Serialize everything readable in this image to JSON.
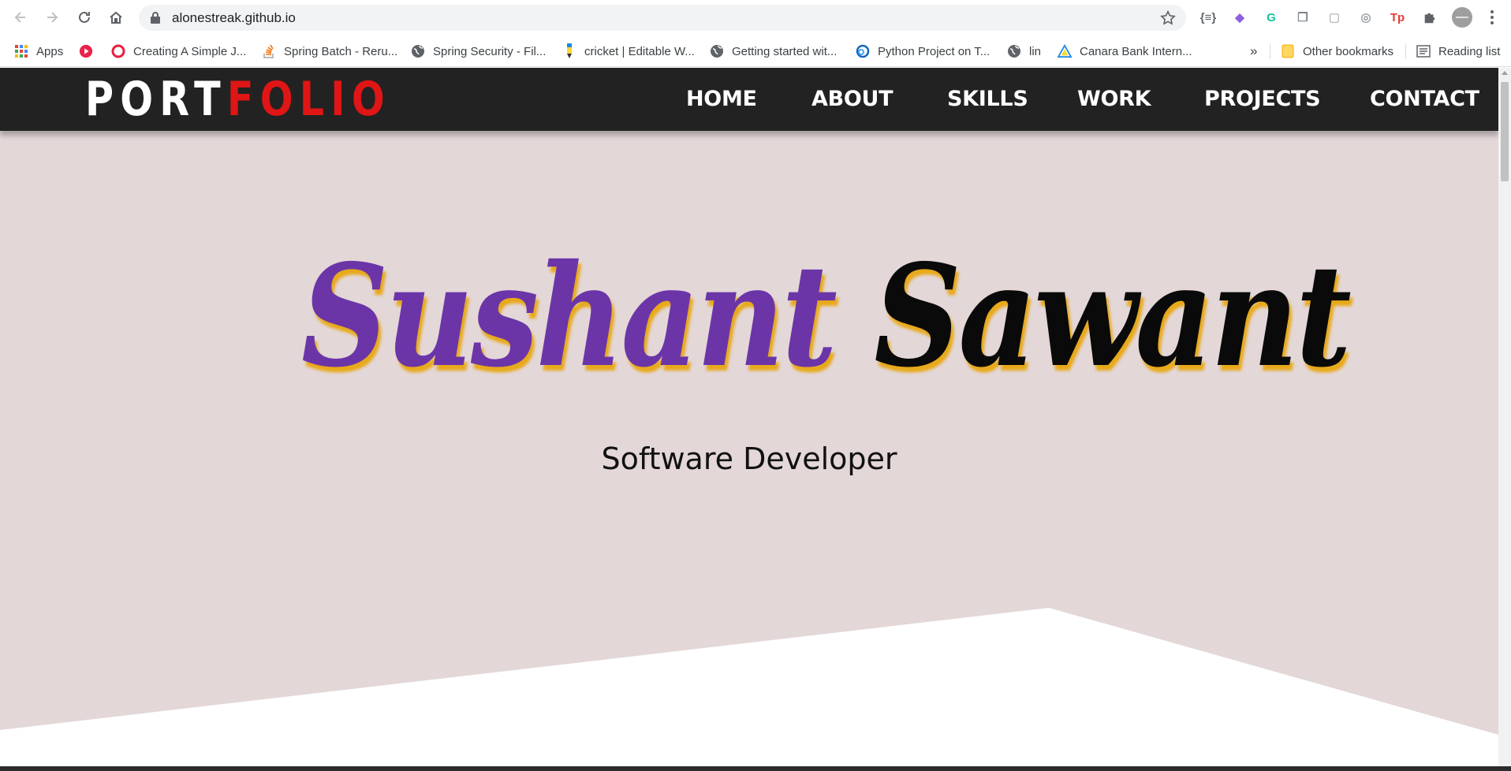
{
  "browser": {
    "url": "alonestreak.github.io",
    "icons": {
      "back": "arrow-left-icon",
      "forward": "arrow-right-icon",
      "reload": "reload-icon",
      "home": "home-icon",
      "lock": "lock-icon",
      "star": "star-icon",
      "extensions": "puzzle-icon",
      "menu": "kebab-menu-icon"
    },
    "extensions": [
      {
        "name": "json-viewer-extension-icon",
        "glyph": "{≡}",
        "color": "#5f6368"
      },
      {
        "name": "purple-extension-icon",
        "glyph": "◆",
        "color": "#8e5fe0"
      },
      {
        "name": "grammarly-extension-icon",
        "glyph": "G",
        "color": "#15c39a"
      },
      {
        "name": "copy-extension-icon",
        "glyph": "❐",
        "color": "#80868b"
      },
      {
        "name": "blank-extension-icon",
        "glyph": "▢",
        "color": "#bdbdbd"
      },
      {
        "name": "target-extension-icon",
        "glyph": "◎",
        "color": "#9aa0a6"
      },
      {
        "name": "tp-extension-icon",
        "glyph": "Tp",
        "color": "#e53935"
      }
    ]
  },
  "bookmarks": {
    "items": [
      {
        "label": "Apps",
        "icon": "apps-grid-icon"
      },
      {
        "label": "",
        "icon": "play-circle-icon"
      },
      {
        "label": "Creating A Simple J...",
        "icon": "opera-icon"
      },
      {
        "label": "Spring Batch - Reru...",
        "icon": "stack-overflow-icon"
      },
      {
        "label": "Spring Security - Fil...",
        "icon": "globe-icon"
      },
      {
        "label": "cricket | Editable W...",
        "icon": "pencil-icon"
      },
      {
        "label": "Getting started wit...",
        "icon": "globe-icon"
      },
      {
        "label": "Python Project on T...",
        "icon": "link-icon"
      },
      {
        "label": "lin",
        "icon": "globe-icon"
      },
      {
        "label": "Canara Bank Intern...",
        "icon": "triangle-icon"
      }
    ],
    "overflow": "»",
    "other": "Other bookmarks",
    "reading_list": "Reading list"
  },
  "site": {
    "logo": {
      "part1": "PORT",
      "part2": "FOLIO"
    },
    "menu": [
      "HOME",
      "ABOUT",
      "SKILLS",
      "WORK",
      "PROJECTS",
      "CONTACT"
    ],
    "hero": {
      "first_name": "Sushant",
      "last_name": "Sawant",
      "role": "Software Developer"
    },
    "colors": {
      "nav_bg": "#222222",
      "hero_bg": "#e3d7d8",
      "accent_red": "#e01515",
      "name_purple": "#6b35a8",
      "name_shadow": "#e8a91a"
    }
  }
}
